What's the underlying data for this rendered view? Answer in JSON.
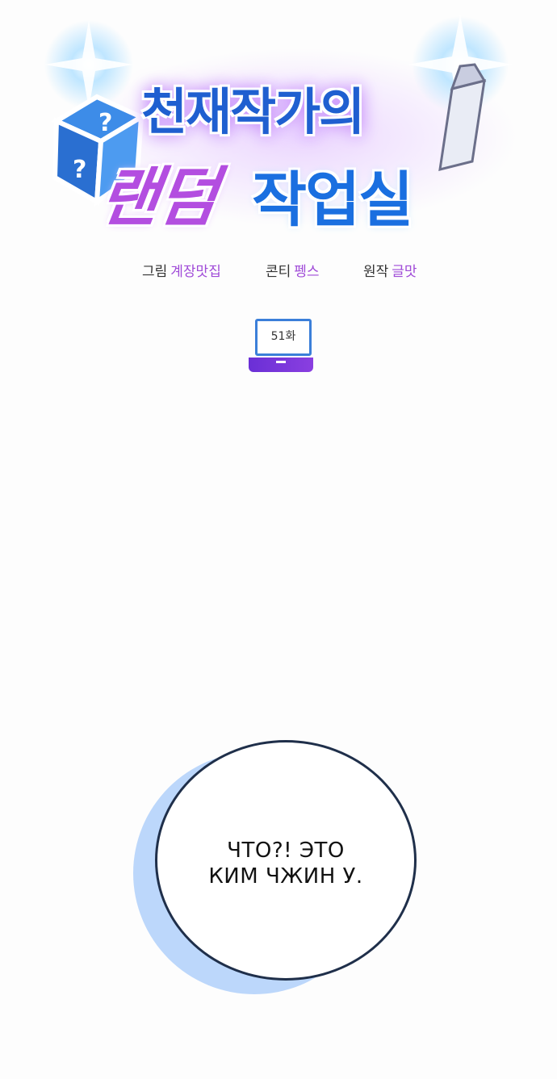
{
  "logo": {
    "line1": "천재작가의",
    "line2_part1": "랜덤",
    "line2_part2": "작업실",
    "colors": {
      "blue": "#1f5fd0",
      "purple": "#b34ee0",
      "glow": "#c98bff"
    },
    "icons": [
      "dice-icon",
      "fountain-pen-icon",
      "sparkle-icon"
    ]
  },
  "credits": [
    {
      "role": "그림",
      "name": "계장맛집",
      "name_color": "#a04bd8"
    },
    {
      "role": "콘티",
      "name": "펭스",
      "name_color": "#a04bd8"
    },
    {
      "role": "원작",
      "name": "글맛",
      "name_color": "#a04bd8"
    }
  ],
  "episode": {
    "label": "51화",
    "icon": "laptop-icon"
  },
  "speech_bubble": {
    "line1": "ЧТО?! ЭТО",
    "line2": "КИМ ЧЖИН У."
  }
}
